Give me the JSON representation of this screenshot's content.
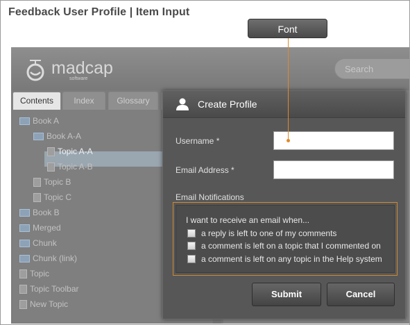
{
  "page": {
    "title": "Feedback User Profile  |  Item Input"
  },
  "callout": {
    "label": "Font"
  },
  "app": {
    "logo": {
      "name": "madcap",
      "sub": "software"
    },
    "search_placeholder": "Search",
    "tabs": [
      {
        "label": "Contents",
        "active": true
      },
      {
        "label": "Index",
        "active": false
      },
      {
        "label": "Glossary",
        "active": false
      }
    ],
    "toc": [
      {
        "label": "Book A",
        "type": "book",
        "indent": 0
      },
      {
        "label": "Book A-A",
        "type": "book",
        "indent": 1
      },
      {
        "label": "Topic A-A",
        "type": "page",
        "indent": 2,
        "selected": true
      },
      {
        "label": "Topic A-B",
        "type": "page",
        "indent": 2
      },
      {
        "label": "Topic B",
        "type": "page",
        "indent": 1
      },
      {
        "label": "Topic C",
        "type": "page",
        "indent": 1
      },
      {
        "label": "Book B",
        "type": "book",
        "indent": 0
      },
      {
        "label": "Merged",
        "type": "book",
        "indent": 0
      },
      {
        "label": "Chunk",
        "type": "book",
        "indent": 0
      },
      {
        "label": "Chunk (link)",
        "type": "book",
        "indent": 0
      },
      {
        "label": "Topic",
        "type": "page",
        "indent": 0
      },
      {
        "label": "Topic Toolbar",
        "type": "page",
        "indent": 0
      },
      {
        "label": "New Topic",
        "type": "page",
        "indent": 0
      }
    ]
  },
  "dialog": {
    "title": "Create Profile",
    "username_label": "Username *",
    "username_value": "",
    "email_label": "Email Address *",
    "email_value": "",
    "notifications_label": "Email Notifications",
    "notifications_intro": "I want to receive an email when...",
    "options": [
      {
        "label": "a reply is left to one of my comments",
        "checked": false
      },
      {
        "label": "a comment is left on a topic that I commented on",
        "checked": false
      },
      {
        "label": "a comment is left on any topic in the Help system",
        "checked": false
      }
    ],
    "submit_label": "Submit",
    "cancel_label": "Cancel"
  },
  "colors": {
    "callout_line": "#e08a2a",
    "notif_border": "#d08a32",
    "dialog_bg": "#575757"
  }
}
